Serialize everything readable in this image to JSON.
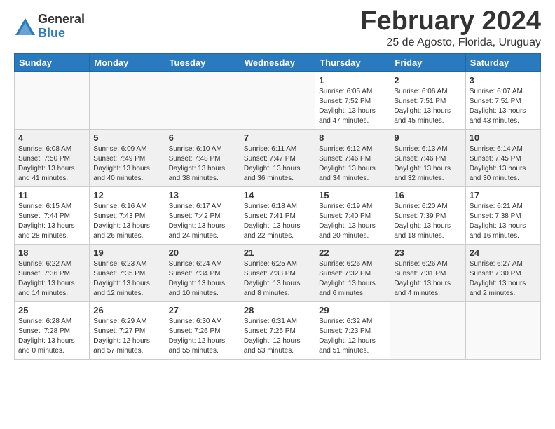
{
  "header": {
    "logo_general": "General",
    "logo_blue": "Blue",
    "month_title": "February 2024",
    "location": "25 de Agosto, Florida, Uruguay"
  },
  "days_of_week": [
    "Sunday",
    "Monday",
    "Tuesday",
    "Wednesday",
    "Thursday",
    "Friday",
    "Saturday"
  ],
  "weeks": [
    [
      {
        "day": "",
        "info": ""
      },
      {
        "day": "",
        "info": ""
      },
      {
        "day": "",
        "info": ""
      },
      {
        "day": "",
        "info": ""
      },
      {
        "day": "1",
        "info": "Sunrise: 6:05 AM\nSunset: 7:52 PM\nDaylight: 13 hours\nand 47 minutes."
      },
      {
        "day": "2",
        "info": "Sunrise: 6:06 AM\nSunset: 7:51 PM\nDaylight: 13 hours\nand 45 minutes."
      },
      {
        "day": "3",
        "info": "Sunrise: 6:07 AM\nSunset: 7:51 PM\nDaylight: 13 hours\nand 43 minutes."
      }
    ],
    [
      {
        "day": "4",
        "info": "Sunrise: 6:08 AM\nSunset: 7:50 PM\nDaylight: 13 hours\nand 41 minutes."
      },
      {
        "day": "5",
        "info": "Sunrise: 6:09 AM\nSunset: 7:49 PM\nDaylight: 13 hours\nand 40 minutes."
      },
      {
        "day": "6",
        "info": "Sunrise: 6:10 AM\nSunset: 7:48 PM\nDaylight: 13 hours\nand 38 minutes."
      },
      {
        "day": "7",
        "info": "Sunrise: 6:11 AM\nSunset: 7:47 PM\nDaylight: 13 hours\nand 36 minutes."
      },
      {
        "day": "8",
        "info": "Sunrise: 6:12 AM\nSunset: 7:46 PM\nDaylight: 13 hours\nand 34 minutes."
      },
      {
        "day": "9",
        "info": "Sunrise: 6:13 AM\nSunset: 7:46 PM\nDaylight: 13 hours\nand 32 minutes."
      },
      {
        "day": "10",
        "info": "Sunrise: 6:14 AM\nSunset: 7:45 PM\nDaylight: 13 hours\nand 30 minutes."
      }
    ],
    [
      {
        "day": "11",
        "info": "Sunrise: 6:15 AM\nSunset: 7:44 PM\nDaylight: 13 hours\nand 28 minutes."
      },
      {
        "day": "12",
        "info": "Sunrise: 6:16 AM\nSunset: 7:43 PM\nDaylight: 13 hours\nand 26 minutes."
      },
      {
        "day": "13",
        "info": "Sunrise: 6:17 AM\nSunset: 7:42 PM\nDaylight: 13 hours\nand 24 minutes."
      },
      {
        "day": "14",
        "info": "Sunrise: 6:18 AM\nSunset: 7:41 PM\nDaylight: 13 hours\nand 22 minutes."
      },
      {
        "day": "15",
        "info": "Sunrise: 6:19 AM\nSunset: 7:40 PM\nDaylight: 13 hours\nand 20 minutes."
      },
      {
        "day": "16",
        "info": "Sunrise: 6:20 AM\nSunset: 7:39 PM\nDaylight: 13 hours\nand 18 minutes."
      },
      {
        "day": "17",
        "info": "Sunrise: 6:21 AM\nSunset: 7:38 PM\nDaylight: 13 hours\nand 16 minutes."
      }
    ],
    [
      {
        "day": "18",
        "info": "Sunrise: 6:22 AM\nSunset: 7:36 PM\nDaylight: 13 hours\nand 14 minutes."
      },
      {
        "day": "19",
        "info": "Sunrise: 6:23 AM\nSunset: 7:35 PM\nDaylight: 13 hours\nand 12 minutes."
      },
      {
        "day": "20",
        "info": "Sunrise: 6:24 AM\nSunset: 7:34 PM\nDaylight: 13 hours\nand 10 minutes."
      },
      {
        "day": "21",
        "info": "Sunrise: 6:25 AM\nSunset: 7:33 PM\nDaylight: 13 hours\nand 8 minutes."
      },
      {
        "day": "22",
        "info": "Sunrise: 6:26 AM\nSunset: 7:32 PM\nDaylight: 13 hours\nand 6 minutes."
      },
      {
        "day": "23",
        "info": "Sunrise: 6:26 AM\nSunset: 7:31 PM\nDaylight: 13 hours\nand 4 minutes."
      },
      {
        "day": "24",
        "info": "Sunrise: 6:27 AM\nSunset: 7:30 PM\nDaylight: 13 hours\nand 2 minutes."
      }
    ],
    [
      {
        "day": "25",
        "info": "Sunrise: 6:28 AM\nSunset: 7:28 PM\nDaylight: 13 hours\nand 0 minutes."
      },
      {
        "day": "26",
        "info": "Sunrise: 6:29 AM\nSunset: 7:27 PM\nDaylight: 12 hours\nand 57 minutes."
      },
      {
        "day": "27",
        "info": "Sunrise: 6:30 AM\nSunset: 7:26 PM\nDaylight: 12 hours\nand 55 minutes."
      },
      {
        "day": "28",
        "info": "Sunrise: 6:31 AM\nSunset: 7:25 PM\nDaylight: 12 hours\nand 53 minutes."
      },
      {
        "day": "29",
        "info": "Sunrise: 6:32 AM\nSunset: 7:23 PM\nDaylight: 12 hours\nand 51 minutes."
      },
      {
        "day": "",
        "info": ""
      },
      {
        "day": "",
        "info": ""
      }
    ]
  ]
}
